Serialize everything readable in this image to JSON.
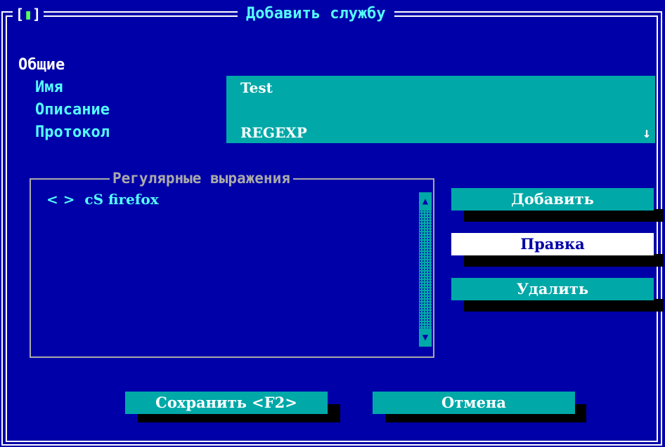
{
  "dialog": {
    "title": "Добавить службу",
    "close_box_left": "[",
    "close_box_ind": "▮",
    "close_box_right": "]"
  },
  "general": {
    "section_label": "Общие",
    "name_label": "Имя",
    "description_label": "Описание",
    "protocol_label": "Протокол",
    "name_value": "Test",
    "description_value": "",
    "protocol_value": "REGEXP",
    "protocol_arrow": "↓"
  },
  "regex_group": {
    "title": "Регулярные выражения",
    "items": [
      {
        "text": "< >  cS firefox"
      }
    ],
    "scroll_up": "▲",
    "scroll_down": "▼"
  },
  "side_buttons": {
    "add": "Добавить",
    "edit": "Правка",
    "delete": "Удалить"
  },
  "bottom_buttons": {
    "save": "Сохранить <F2>",
    "cancel": "Отмена"
  },
  "colors": {
    "background": "#0000a8",
    "field": "#00a8a8",
    "label": "#55ffff",
    "selected_button": "#ffffff"
  }
}
